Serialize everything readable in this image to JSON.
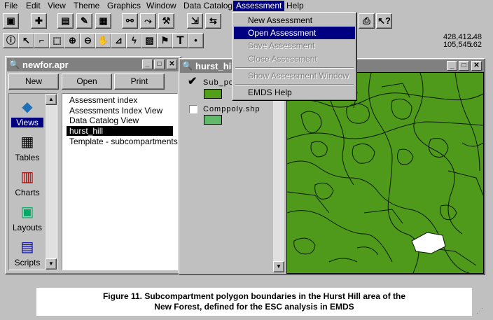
{
  "menubar": {
    "items": [
      "File",
      "Edit",
      "View",
      "Theme",
      "Graphics",
      "Window",
      "Data Catalog",
      "Assessment",
      "Help"
    ],
    "active": "Assessment"
  },
  "toolbar": {
    "coords": {
      "x": "428,412.48",
      "y": "105,545.62"
    }
  },
  "assessment_menu": {
    "items": [
      {
        "label": "New Assessment",
        "state": "enabled"
      },
      {
        "label": "Open Assessment",
        "state": "highlighted"
      },
      {
        "label": "Save Assessment",
        "state": "disabled"
      },
      {
        "label": "Close Assessment",
        "state": "disabled"
      },
      {
        "label": "Show Assessment Window",
        "state": "disabled"
      },
      {
        "label": "EMDS Help",
        "state": "enabled"
      }
    ]
  },
  "project_window": {
    "title": "newfor.apr",
    "buttons": {
      "new": "New",
      "open": "Open",
      "print": "Print"
    },
    "doc_types": [
      "Views",
      "Tables",
      "Charts",
      "Layouts",
      "Scripts"
    ],
    "selected_doc_type": "Views",
    "list_items": [
      "Assessment index",
      "Assessments Index View",
      "Data Catalog View",
      "hurst_hill",
      "Template - subcompartments"
    ],
    "selected_item": "hurst_hill"
  },
  "view_window": {
    "title": "hurst_hill",
    "themes": [
      {
        "name": "Sub_po",
        "checked": true,
        "color": "#52a019"
      },
      {
        "name": "Comppoly.shp",
        "checked": false,
        "color": "#5fba6a"
      }
    ],
    "map_color": "#4f9a1a"
  },
  "caption": {
    "line1": "Figure 11. Subcompartment polygon boundaries  in  the Hurst Hill area of the",
    "line2": "New Forest, defined for the ESC analysis in EMDS"
  }
}
